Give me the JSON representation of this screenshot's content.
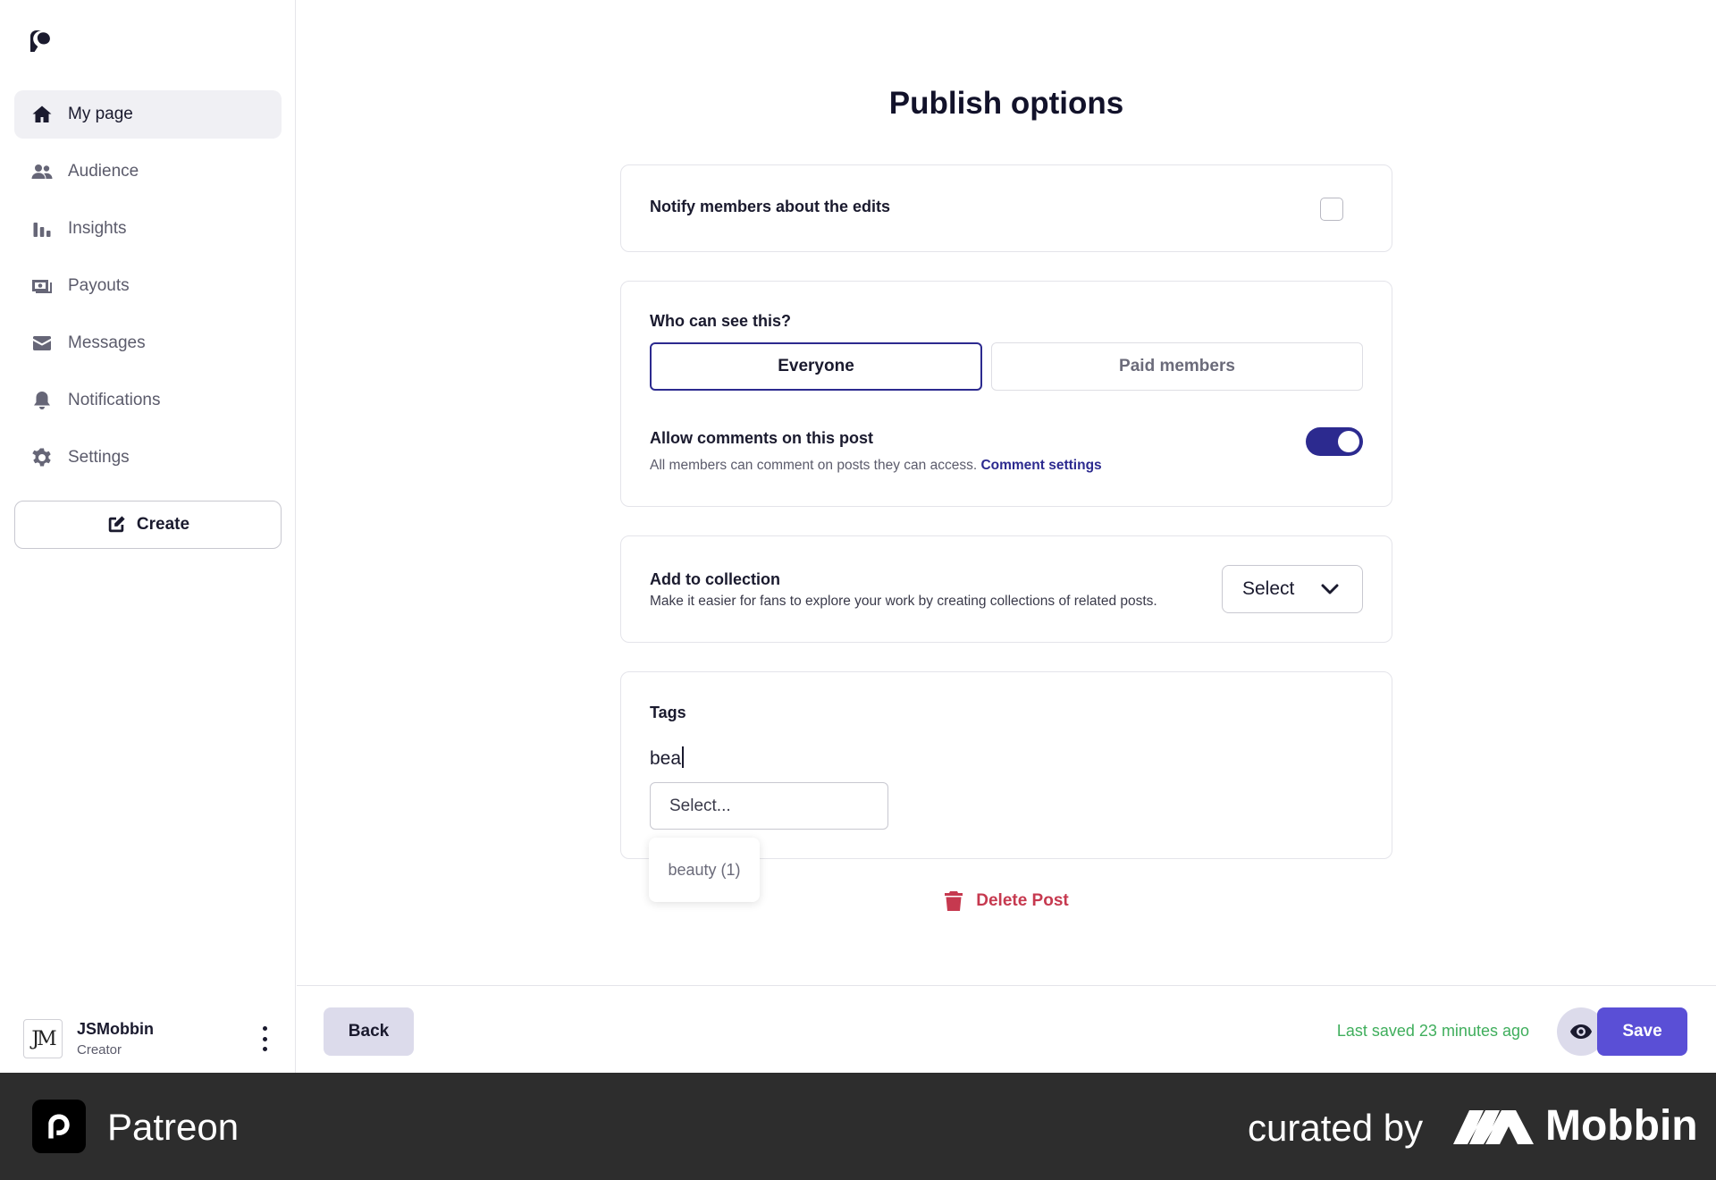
{
  "app": {
    "name": "Patreon"
  },
  "sidebar": {
    "items": [
      {
        "label": "My page",
        "icon": "home-icon",
        "active": true
      },
      {
        "label": "Audience",
        "icon": "people-icon"
      },
      {
        "label": "Insights",
        "icon": "bar-chart-icon"
      },
      {
        "label": "Payouts",
        "icon": "money-icon"
      },
      {
        "label": "Messages",
        "icon": "envelope-icon"
      },
      {
        "label": "Notifications",
        "icon": "bell-icon"
      },
      {
        "label": "Settings",
        "icon": "gear-icon"
      }
    ],
    "create_label": "Create",
    "user": {
      "name": "JSMobbin",
      "role": "Creator",
      "avatar_text": "JM"
    }
  },
  "main": {
    "title": "Publish options",
    "notify": {
      "label": "Notify members about the edits",
      "checked": false
    },
    "visibility": {
      "label": "Who can see this?",
      "options": [
        "Everyone",
        "Paid members"
      ],
      "selected": "Everyone"
    },
    "comments": {
      "label": "Allow comments on this post",
      "description": "All members can comment on posts they can access.",
      "link": "Comment settings",
      "enabled": true
    },
    "collection": {
      "label": "Add to collection",
      "description": "Make it easier for fans to explore your work by creating collections of related posts.",
      "select_label": "Select"
    },
    "tags": {
      "label": "Tags",
      "input_value": "bea",
      "select_placeholder": "Select...",
      "suggestion": "beauty (1)"
    },
    "delete_label": "Delete Post"
  },
  "footer": {
    "back_label": "Back",
    "saved_text": "Last saved 23 minutes ago",
    "save_label": "Save"
  },
  "brand_bar": {
    "app_name": "Patreon",
    "curated_text": "curated by",
    "curator_name": "Mobbin"
  },
  "colors": {
    "accent": "#2c2a8f",
    "save": "#5a4fd6",
    "danger": "#c6394f",
    "success": "#3fae5c"
  }
}
